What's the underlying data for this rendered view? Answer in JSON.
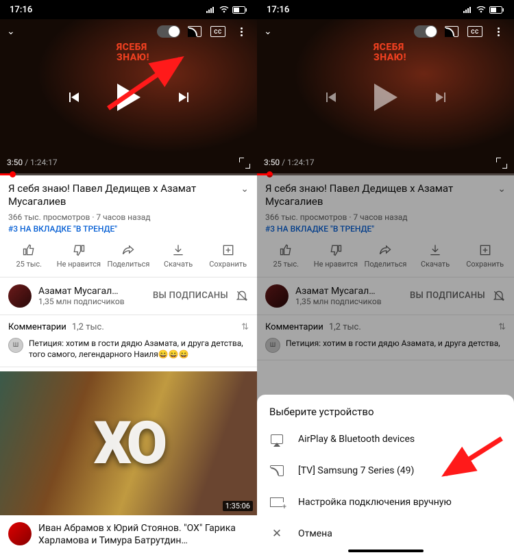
{
  "status": {
    "time": "17:16"
  },
  "player": {
    "sign_line1": "ЯСЕБЯ",
    "sign_line2": "ЗНАЮ!",
    "cc_label": "CC",
    "current_time": "3:50",
    "total_time": "1:24:17"
  },
  "video": {
    "title": "Я себя знаю! Павел Дедищев х Азамат Мусагалиев",
    "views_age": "366 тыс. просмотров · 7 часов назад",
    "trending": "#3 НА ВКЛАДКЕ \"В ТРЕНДЕ\""
  },
  "actions": {
    "like": "25 тыс.",
    "dislike": "Не нравится",
    "share": "Поделиться",
    "download": "Скачать",
    "save": "Сохранить"
  },
  "channel": {
    "name": "Азамат Мусагал…",
    "subs": "1,35 млн подписчиков",
    "subscribed": "ВЫ ПОДПИСАНЫ"
  },
  "comments": {
    "label": "Комментарии",
    "count": "1,2 тыс.",
    "top": "Петиция: хотим в гости дядю Азамата, и друга детства, того самого, легендарного Наиля😄😄😄",
    "top_short": "Петиция: хотим в гости дядю Азамата, и друга детства,"
  },
  "next": {
    "duration": "1:35:06",
    "title": "Иван Абрамов х Юрий Стоянов. \"ОХ\" Гарика Харламова и Тимура Батрутдин…"
  },
  "sheet": {
    "title": "Выберите устройство",
    "airplay": "AirPlay & Bluetooth devices",
    "tv": "[TV] Samsung 7 Series (49)",
    "manual": "Настройка подключения вручную",
    "cancel": "Отмена"
  }
}
